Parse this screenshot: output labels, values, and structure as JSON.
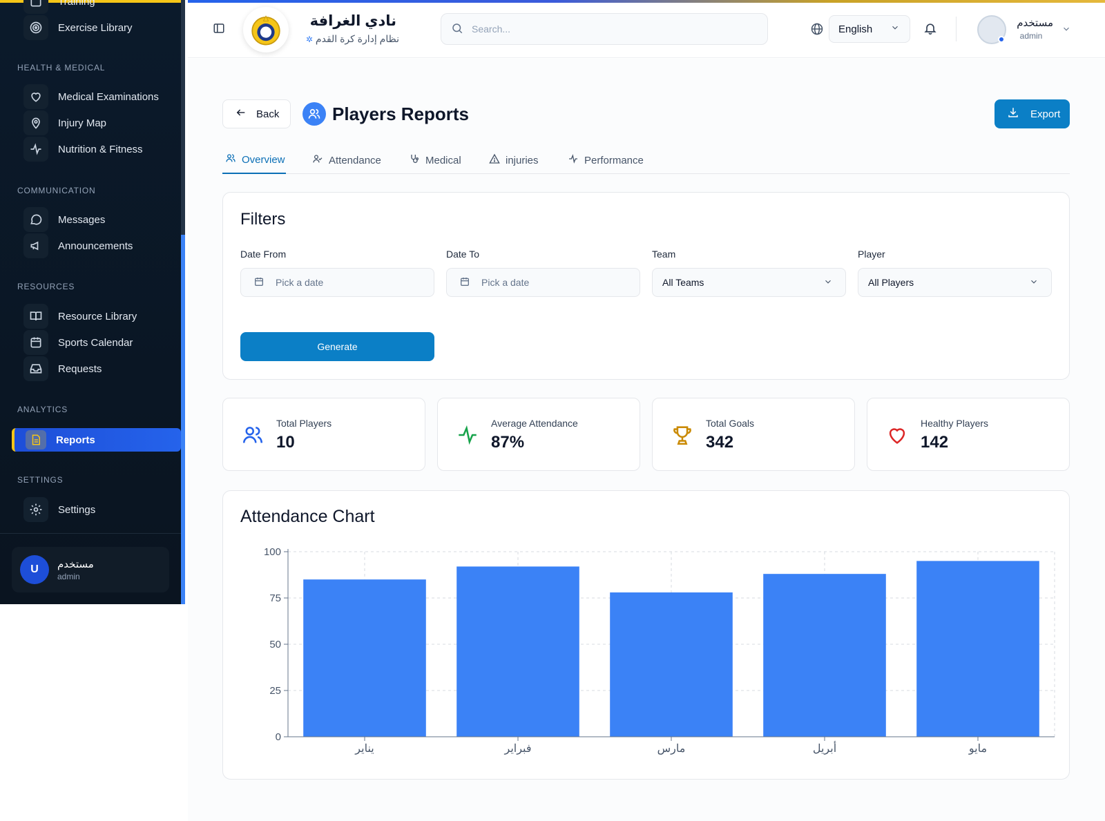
{
  "sidebar": {
    "top_partial_label": "Training",
    "exercise_library": "Exercise Library",
    "sections": {
      "health": "HEALTH & MEDICAL",
      "communication": "COMMUNICATION",
      "resources": "RESOURCES",
      "analytics": "ANALYTICS",
      "settings": "SETTINGS"
    },
    "items": {
      "medical": "Medical Examinations",
      "injury_map": "Injury Map",
      "nutrition": "Nutrition & Fitness",
      "messages": "Messages",
      "announcements": "Announcements",
      "resource_library": "Resource Library",
      "sports_calendar": "Sports Calendar",
      "requests": "Requests",
      "reports": "Reports",
      "settings": "Settings"
    },
    "user": {
      "initial": "U",
      "name": "مستخدم",
      "role": "admin"
    }
  },
  "header": {
    "club_name": "نادي الغرافة",
    "club_subtitle": "نظام إدارة كرة القدم",
    "search_placeholder": "Search...",
    "language": "English",
    "user_name": "مستخدم",
    "user_role": "admin"
  },
  "page": {
    "back_label": "Back",
    "title": "Players Reports",
    "export_label": "Export",
    "tabs": [
      "Overview",
      "Attendance",
      "Medical",
      "injuries",
      "Performance"
    ],
    "active_tab": "Overview"
  },
  "filters": {
    "title": "Filters",
    "date_from_label": "Date From",
    "date_from_placeholder": "Pick a date",
    "date_to_label": "Date To",
    "date_to_placeholder": "Pick a date",
    "team_label": "Team",
    "team_value": "All Teams",
    "player_label": "Player",
    "player_value": "All Players",
    "generate_label": "Generate"
  },
  "stats": [
    {
      "label": "Total Players",
      "value": "10",
      "icon": "users-icon",
      "color": "#2563eb"
    },
    {
      "label": "Average Attendance",
      "value": "87%",
      "icon": "activity-icon",
      "color": "#16a34a"
    },
    {
      "label": "Total Goals",
      "value": "342",
      "icon": "trophy-icon",
      "color": "#ca8a04"
    },
    {
      "label": "Healthy Players",
      "value": "142",
      "icon": "heart-icon",
      "color": "#dc2626"
    }
  ],
  "chart_title": "Attendance Chart",
  "chart_data": {
    "type": "bar",
    "categories": [
      "يناير",
      "فبراير",
      "مارس",
      "أبريل",
      "مايو"
    ],
    "values": [
      85,
      92,
      78,
      88,
      95
    ],
    "ylim": [
      0,
      100
    ],
    "yticks": [
      0,
      25,
      50,
      75,
      100
    ],
    "grid": true,
    "bar_color": "#3b82f6"
  },
  "colors": {
    "accent": "#0b7fc6",
    "sidebar_bg": "#0b1a2b",
    "active_nav": "#2563eb",
    "gold": "#f5c518"
  }
}
